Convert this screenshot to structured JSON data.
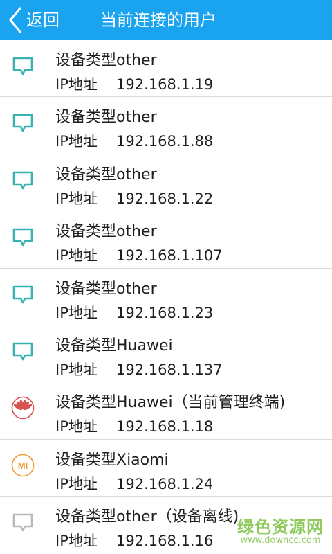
{
  "header": {
    "back_label": "返回",
    "title": "当前连接的用户",
    "background": "#1aa3ef"
  },
  "devices": [
    {
      "type_label": "设备类型other",
      "ip_label": "IP地址",
      "ip": "192.168.1.19",
      "icon": "monitor-icon",
      "icon_color": "#36b3b0"
    },
    {
      "type_label": "设备类型other",
      "ip_label": "IP地址",
      "ip": "192.168.1.88",
      "icon": "monitor-icon",
      "icon_color": "#36b3b0"
    },
    {
      "type_label": "设备类型other",
      "ip_label": "IP地址",
      "ip": "192.168.1.22",
      "icon": "monitor-icon",
      "icon_color": "#36b3b0"
    },
    {
      "type_label": "设备类型other",
      "ip_label": "IP地址",
      "ip": "192.168.1.107",
      "icon": "monitor-icon",
      "icon_color": "#36b3b0"
    },
    {
      "type_label": "设备类型other",
      "ip_label": "IP地址",
      "ip": "192.168.1.23",
      "icon": "monitor-icon",
      "icon_color": "#36b3b0"
    },
    {
      "type_label": "设备类型Huawei",
      "ip_label": "IP地址",
      "ip": "192.168.1.137",
      "icon": "monitor-icon",
      "icon_color": "#36b3b0"
    },
    {
      "type_label": "设备类型Huawei（当前管理终端)",
      "ip_label": "IP地址",
      "ip": "192.168.1.18",
      "icon": "huawei-logo-icon",
      "icon_color": "#d9534f"
    },
    {
      "type_label": "设备类型Xiaomi",
      "ip_label": "IP地址",
      "ip": "192.168.1.24",
      "icon": "xiaomi-logo-icon",
      "icon_color": "#f39a33",
      "icon_text": "MI"
    },
    {
      "type_label": "设备类型other（设备离线)",
      "ip_label": "IP地址",
      "ip": "192.168.1.16",
      "icon": "monitor-offline-icon",
      "icon_color": "#b8b8b8"
    }
  ],
  "watermark": {
    "main": "绿色资源网",
    "url": "www.downcc.com",
    "color": "#7cc142"
  }
}
